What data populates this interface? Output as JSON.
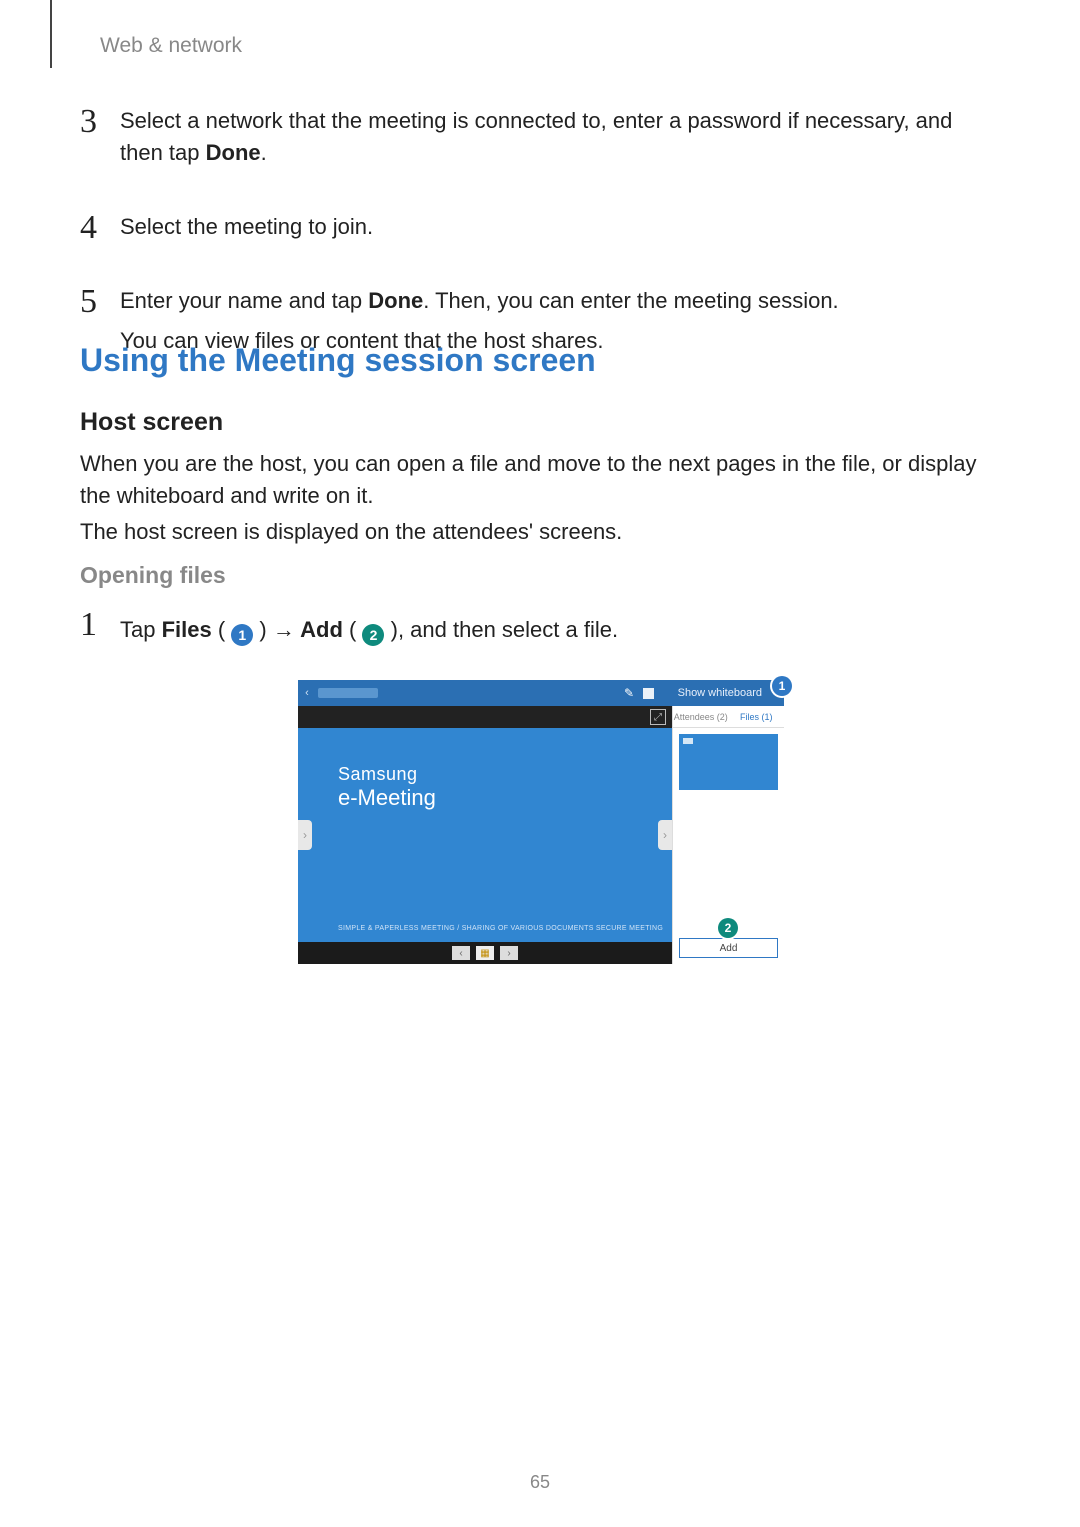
{
  "breadcrumb": "Web & network",
  "steps_top": [
    {
      "num": "3",
      "lines": [
        "Select a network that the meeting is connected to, enter a password if necessary, and then tap ",
        "Done",
        "."
      ]
    },
    {
      "num": "4",
      "lines": [
        "Select the meeting to join."
      ]
    },
    {
      "num": "5",
      "lines": [
        "Enter your name and tap ",
        "Done",
        ". Then, you can enter the meeting session."
      ],
      "extra": "You can view files or content that the host shares."
    }
  ],
  "h2": "Using the Meeting session screen",
  "h3": "Host screen",
  "p1": "When you are the host, you can open a file and move to the next pages in the file, or display the whiteboard and write on it.",
  "p2": "The host screen is displayed on the attendees' screens.",
  "h4": "Opening files",
  "step1": {
    "num": "1",
    "pre": "Tap ",
    "b1": "Files",
    "paren1_open": " ( ",
    "c1": "1",
    "paren1_close": " ) ",
    "arrow": "→",
    "b2": " Add",
    "paren2_open": " ( ",
    "c2": "2",
    "paren2_close": " )",
    "post": ", and then select a file."
  },
  "shot": {
    "show_whiteboard": "Show whiteboard",
    "brand1": "Samsung",
    "brand2": "e-Meeting",
    "tagline": "SIMPLE & PAPERLESS MEETING / SHARING OF VARIOUS DOCUMENTS SECURE MEETING",
    "tab_attendees": "Attendees (2)",
    "tab_files": "Files (1)",
    "add": "Add",
    "callout1": "1",
    "callout2": "2"
  },
  "page_number": "65"
}
